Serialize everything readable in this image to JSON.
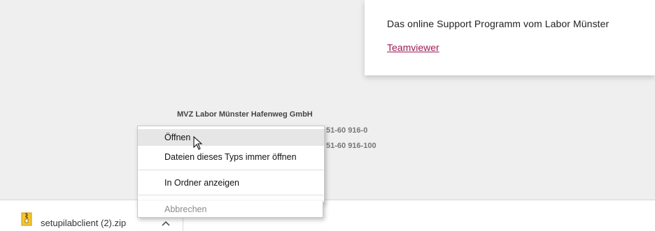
{
  "support": {
    "text": "Das online Support Programm vom Labor Münster",
    "link": "Teamviewer"
  },
  "footer": {
    "company": "MVZ Labor Münster Hafenweg GmbH",
    "phone_partial": "51-60 916-0",
    "fax_partial": "51-60 916-100"
  },
  "download": {
    "filename": "setupilabclient (2).zip",
    "icon": "zip-archive-icon",
    "chevron": "chevron-up-icon"
  },
  "context_menu": {
    "items": [
      {
        "label": "Öffnen",
        "state": "hovered"
      },
      {
        "label": "Dateien dieses Typs immer öffnen",
        "state": "normal"
      },
      {
        "label": "In Ordner anzeigen",
        "state": "normal"
      },
      {
        "label": "Abbrechen",
        "state": "disabled"
      }
    ]
  },
  "colors": {
    "link": "#9b1b55",
    "page_bg": "#efefef",
    "hover_bg": "#e6e6e6"
  }
}
